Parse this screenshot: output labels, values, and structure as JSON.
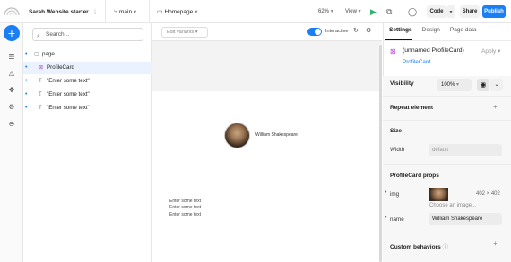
{
  "topbar": {
    "project_name": "Sarah Website starter",
    "project_menu": "⋮",
    "branch": "main",
    "page": "Homepage",
    "zoom": "62%",
    "view": "View",
    "code": "Code",
    "share": "Share",
    "publish": "Publish",
    "accent": "#1a7ff5"
  },
  "layers": {
    "search_placeholder": "Search...",
    "items": [
      {
        "label": "page",
        "icon": "page-icon"
      },
      {
        "label": "ProfileCard",
        "icon": "component-icon"
      },
      {
        "label": "\"Enter some text\"",
        "icon": "text-icon"
      },
      {
        "label": "\"Enter some text\"",
        "icon": "text-icon"
      },
      {
        "label": "\"Enter some text\"",
        "icon": "text-icon"
      }
    ]
  },
  "canvas": {
    "edit_variants": "Edit variants",
    "interactive": "Interactive",
    "profile_name": "William Shakespeare",
    "texts": [
      "Enter some text",
      "Enter some text",
      "Enter some text"
    ]
  },
  "panel": {
    "tabs": [
      "Settings",
      "Design",
      "Page data"
    ],
    "component_title": "(unnamed ProfileCard)",
    "component_link": "ProfileCard",
    "apply": "Apply",
    "visibility_label": "Visibility",
    "visibility_value": "100%",
    "repeat_label": "Repeat element",
    "size_label": "Size",
    "width_label": "Width",
    "width_value": "default",
    "props_label": "ProfileCard props",
    "img_label": "img",
    "img_size": "402 × 402",
    "img_choose": "Choose an image...",
    "name_label": "name",
    "name_value": "William Shakespeare",
    "custom_label": "Custom behaviors"
  }
}
